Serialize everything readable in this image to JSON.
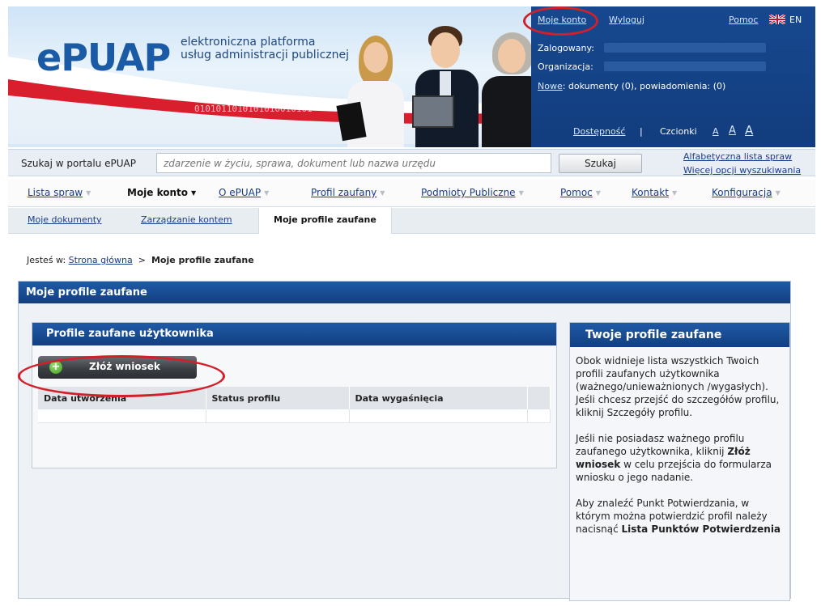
{
  "header": {
    "logo": "ePUAP",
    "tagline_1": "elektroniczna platforma",
    "tagline_2": "usług administracji publicznej",
    "binary": "0101011010101010010101"
  },
  "userpanel": {
    "my_account": "Moje konto",
    "logout": "Wyloguj",
    "help": "Pomoc",
    "lang": "EN",
    "logged_in_label": "Zalogowany:",
    "organization_label": "Organizacja:",
    "new_link": "Nowe",
    "new_text": ": dokumenty (0), powiadomienia: (0)",
    "accessibility": "Dostępność",
    "separator": "|",
    "font_label": "Czcionki",
    "font_a1": "A",
    "font_a2": "A",
    "font_a3": "A"
  },
  "search": {
    "label": "Szukaj w portalu ePUAP",
    "placeholder": "zdarzenie w życiu, sprawa, dokument lub nazwa urzędu",
    "button": "Szukaj",
    "link_1": "Alfabetyczna lista spraw",
    "link_2": "Więcej opcji wyszukiwania"
  },
  "nav": {
    "items": [
      "Lista spraw",
      "Moje konto",
      "O ePUAP",
      "Profil zaufany",
      "Podmioty Publiczne",
      "Pomoc",
      "Kontakt",
      "Konfiguracja"
    ]
  },
  "subnav": {
    "items": [
      "Moje dokumenty",
      "Zarządzanie kontem",
      "Moje profile zaufane"
    ]
  },
  "breadcrumb": {
    "prefix": "Jesteś w:",
    "home": "Strona główna",
    "sep": ">",
    "current": "Moje profile zaufane"
  },
  "main": {
    "title": "Moje profile zaufane",
    "left_title": "Profile zaufane użytkownika",
    "apply_button": "Złóż wniosek",
    "columns": [
      "Data utworzenia",
      "Status profilu",
      "Data wygaśnięcia",
      ""
    ],
    "right_title": "Twoje profile zaufane",
    "p1": "Obok widnieje lista wszystkich Twoich profili zaufanych użytkownika (ważnego/unieważnionych /wygasłych). Jeśli chcesz przejść do szczegółów profilu, kliknij Szczegóły profilu.",
    "p2_a": "Jeśli nie posiadasz ważnego profilu zaufanego użytkownika, kliknij ",
    "p2_b": "Złóż wniosek",
    "p2_c": " w celu przejścia do formularza wniosku o jego nadanie.",
    "p3_a": "Aby znaleźć Punkt Potwierdzania, w którym można potwierdzić profil należy nacisnąć ",
    "p3_b": "Lista Punktów Potwierdzenia"
  },
  "colors": {
    "brand_blue": "#1b5ba6",
    "panel_blue": "#123f80",
    "annotation_red": "#d2202a"
  }
}
